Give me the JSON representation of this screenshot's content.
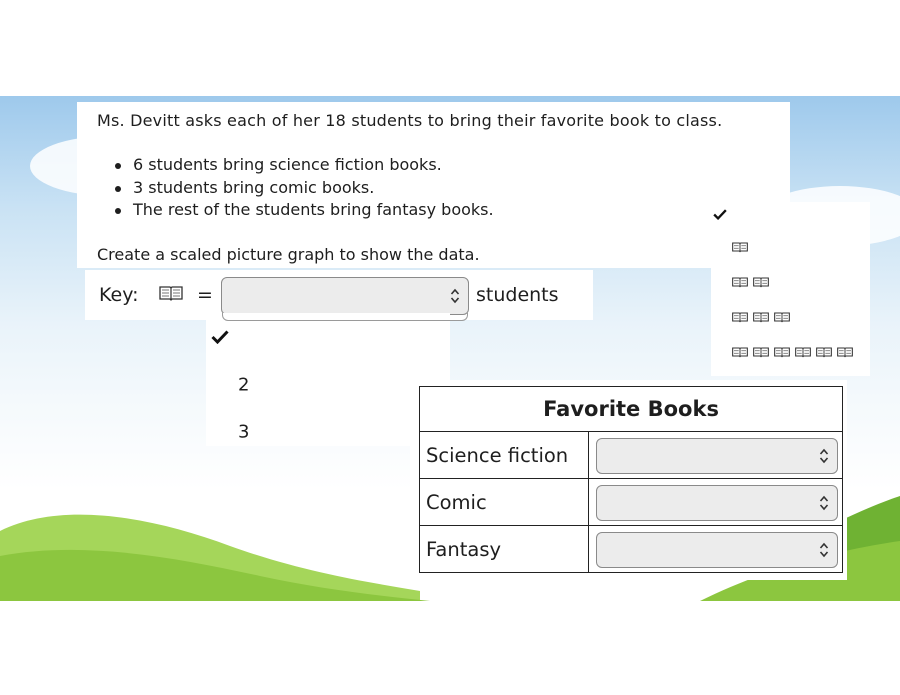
{
  "question": {
    "intro": "Ms. Devitt asks each of her 18 students to bring their favorite book to class.",
    "bullets": [
      "6 students bring science fiction books.",
      "3 students bring comic books.",
      "The rest of the students bring fantasy books."
    ],
    "instruction": "Create a scaled picture graph to show the data."
  },
  "key": {
    "label": "Key:",
    "icon": "book-icon",
    "equals": "=",
    "unit": "students",
    "selected_value": ""
  },
  "key_dropdown": {
    "options": [
      "",
      "2",
      "3"
    ],
    "checked_index": 0
  },
  "icon_dropdown": {
    "options_book_counts": [
      0,
      1,
      2,
      3,
      6
    ],
    "checked_index": 0,
    "icon": "book-icon"
  },
  "table": {
    "title": "Favorite Books",
    "rows": [
      {
        "label": "Science fiction",
        "value": ""
      },
      {
        "label": "Comic",
        "value": ""
      },
      {
        "label": "Fantasy",
        "value": ""
      }
    ]
  },
  "colors": {
    "sky": "#9ec9ec",
    "grass": "#7fbf3a",
    "select_bg": "#ececec",
    "text": "#1e1e1e"
  }
}
